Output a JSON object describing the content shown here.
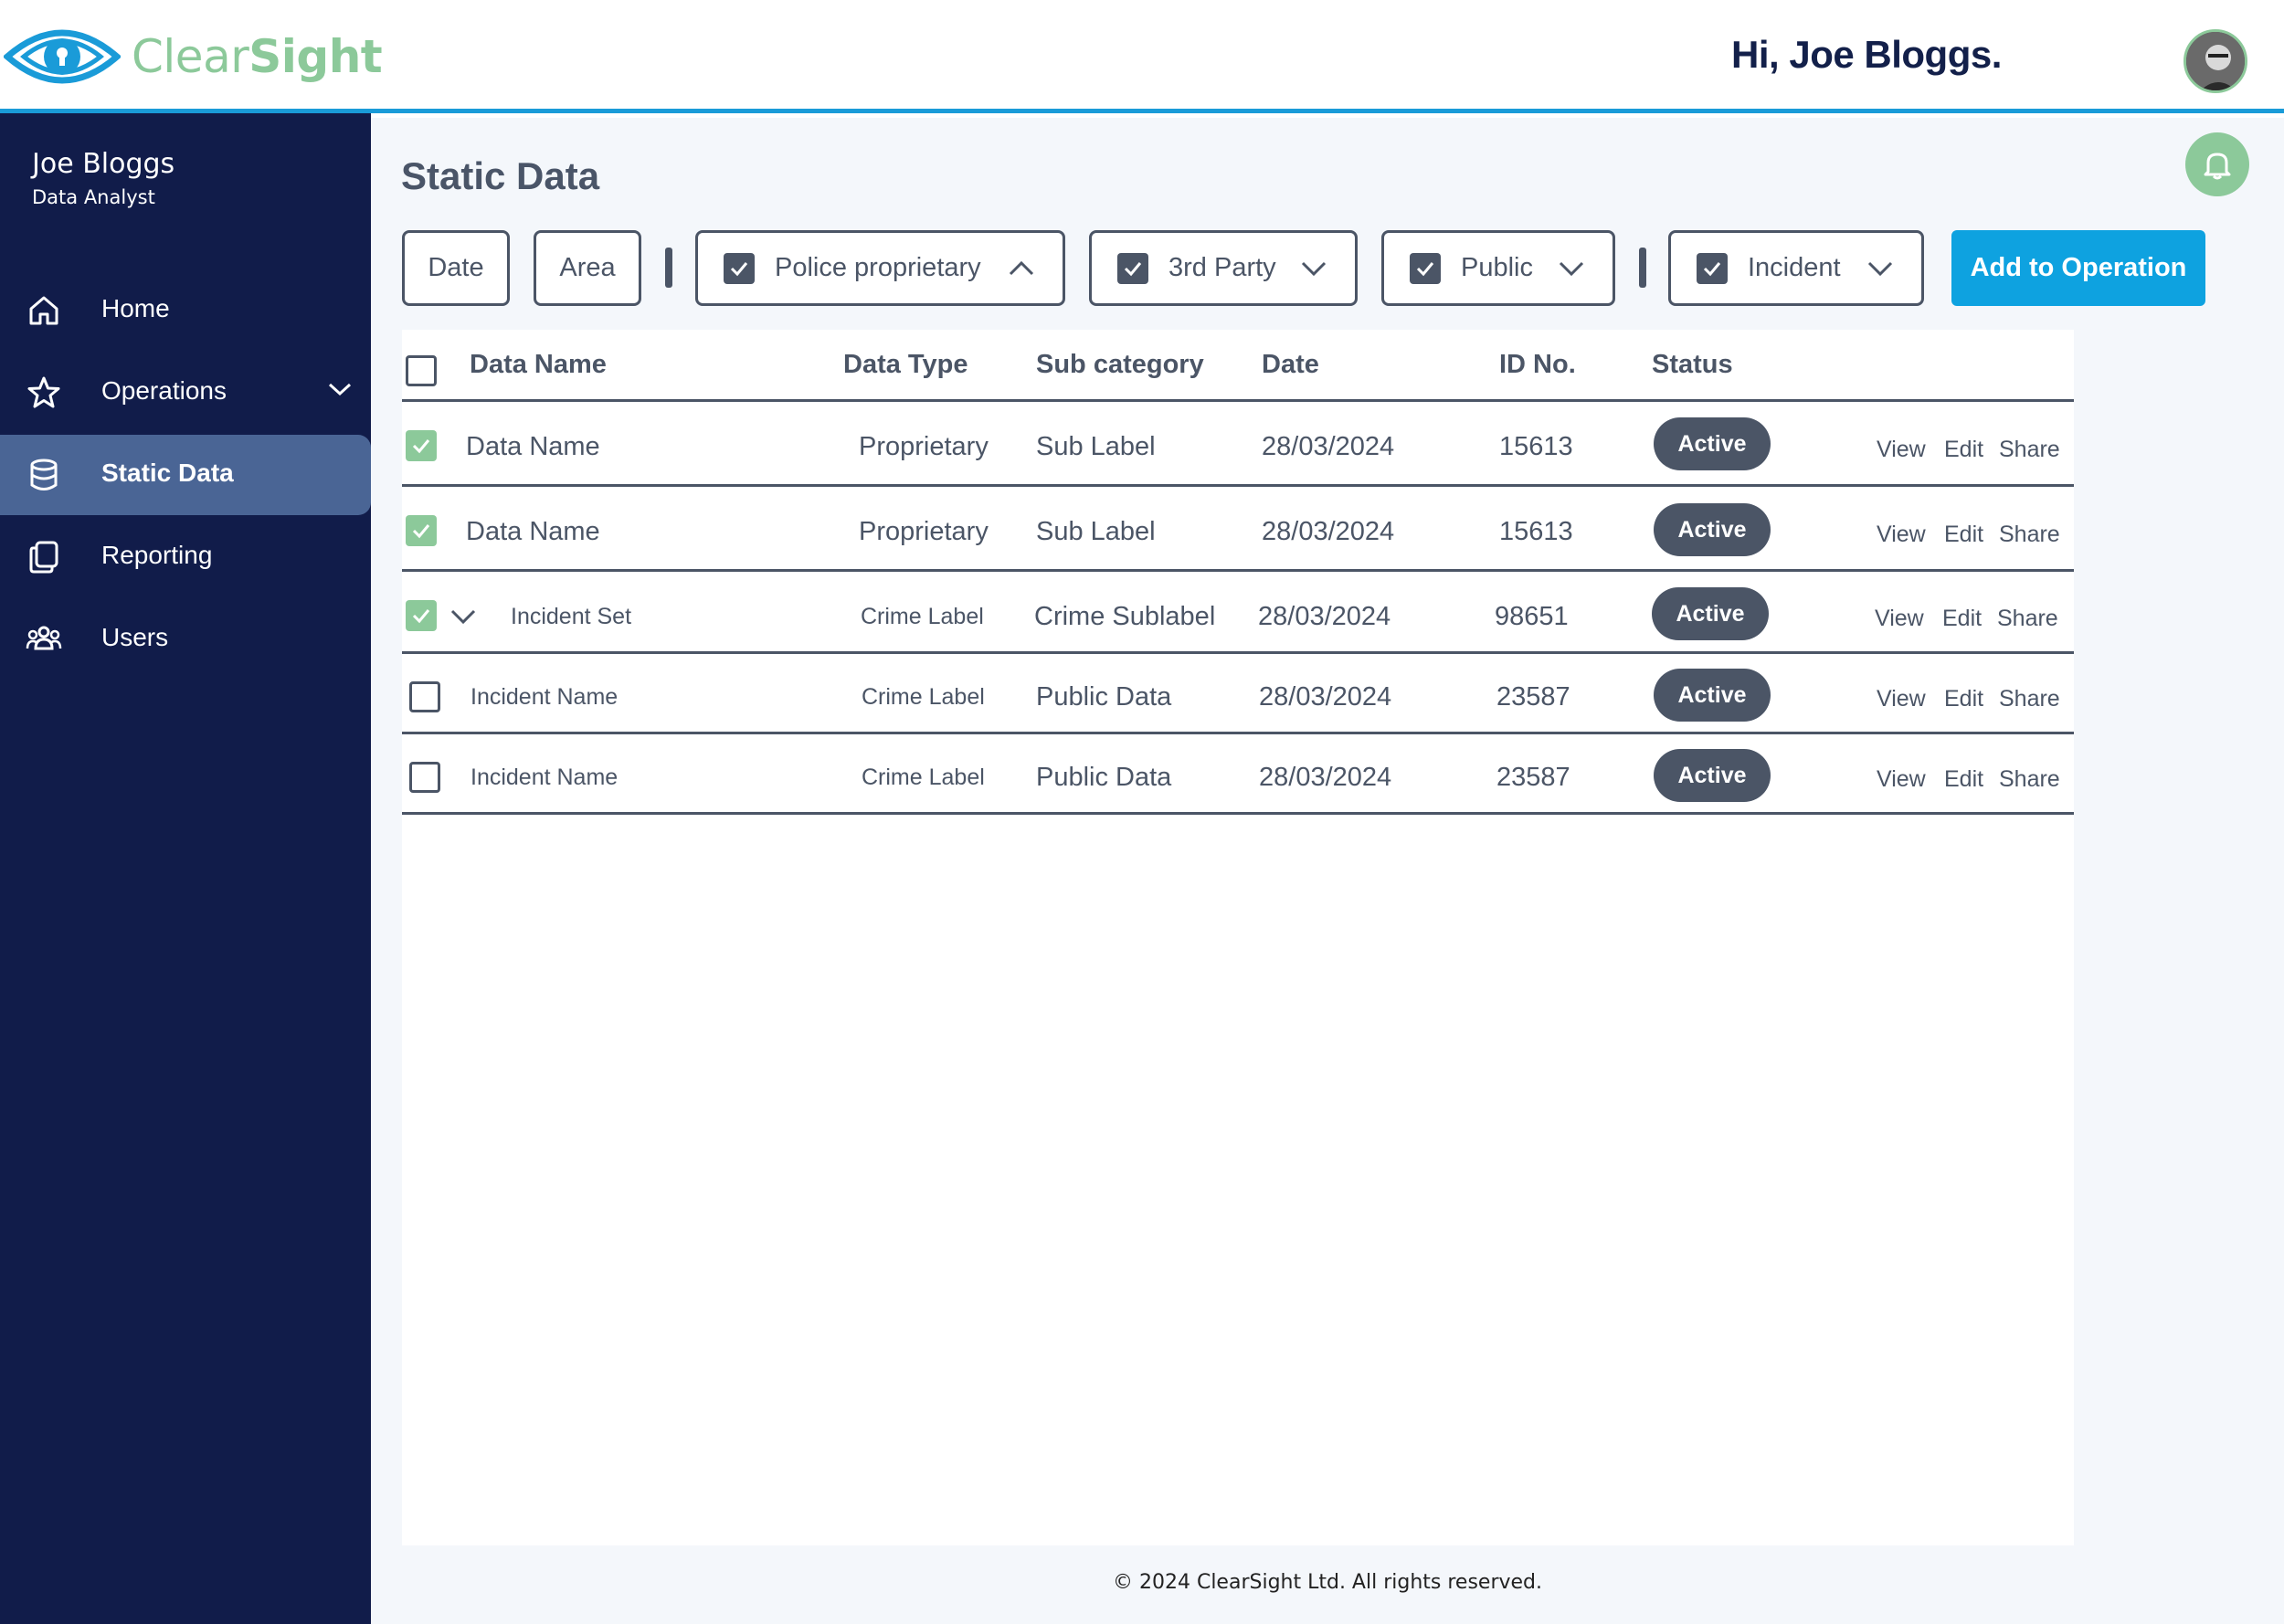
{
  "brand": {
    "name_part1": "Clear",
    "name_part2": "Sight"
  },
  "header": {
    "greeting": "Hi, Joe Bloggs."
  },
  "sidebar": {
    "user_name": "Joe Bloggs",
    "user_role": "Data Analyst",
    "items": [
      {
        "label": "Home",
        "icon": "home-icon",
        "active": false
      },
      {
        "label": "Operations",
        "icon": "star-icon",
        "active": false,
        "expandable": true
      },
      {
        "label": "Static Data",
        "icon": "database-icon",
        "active": true
      },
      {
        "label": "Reporting",
        "icon": "documents-icon",
        "active": false
      },
      {
        "label": "Users",
        "icon": "users-icon",
        "active": false
      }
    ]
  },
  "main": {
    "title": "Static Data",
    "filters": {
      "date": "Date",
      "area": "Area",
      "police": "Police proprietary",
      "third_party": "3rd Party",
      "public": "Public",
      "incident": "Incident"
    },
    "add_button": "Add to Operation"
  },
  "table": {
    "columns": [
      "Data Name",
      "Data Type",
      "Sub category",
      "Date",
      "ID No.",
      "Status"
    ],
    "rows": [
      {
        "checked": true,
        "name": "Data Name",
        "type": "Proprietary",
        "sub": "Sub Label",
        "date": "28/03/2024",
        "id": "15613",
        "status": "Active"
      },
      {
        "checked": true,
        "name": "Data Name",
        "type": "Proprietary",
        "sub": "Sub Label",
        "date": "28/03/2024",
        "id": "15613",
        "status": "Active"
      },
      {
        "checked": true,
        "expand": true,
        "name": "Incident Set",
        "type": "Crime Label",
        "sub": "Crime Sublabel",
        "date": "28/03/2024",
        "id": "98651",
        "status": "Active"
      },
      {
        "checked": false,
        "name": "Incident Name",
        "type": "Crime Label",
        "sub": "Public Data",
        "date": "28/03/2024",
        "id": "23587",
        "status": "Active"
      },
      {
        "checked": false,
        "name": "Incident Name",
        "type": "Crime Label",
        "sub": "Public Data",
        "date": "28/03/2024",
        "id": "23587",
        "status": "Active"
      }
    ],
    "actions": {
      "view": "View",
      "edit": "Edit",
      "share": "Share"
    }
  },
  "footer": {
    "text": "© 2024 ClearSight Ltd. All rights reserved."
  },
  "colors": {
    "navy": "#111c4a",
    "accent_blue": "#0ea2e0",
    "green": "#8cc99a",
    "slate": "#4b5566",
    "active_nav": "#4a6595"
  }
}
